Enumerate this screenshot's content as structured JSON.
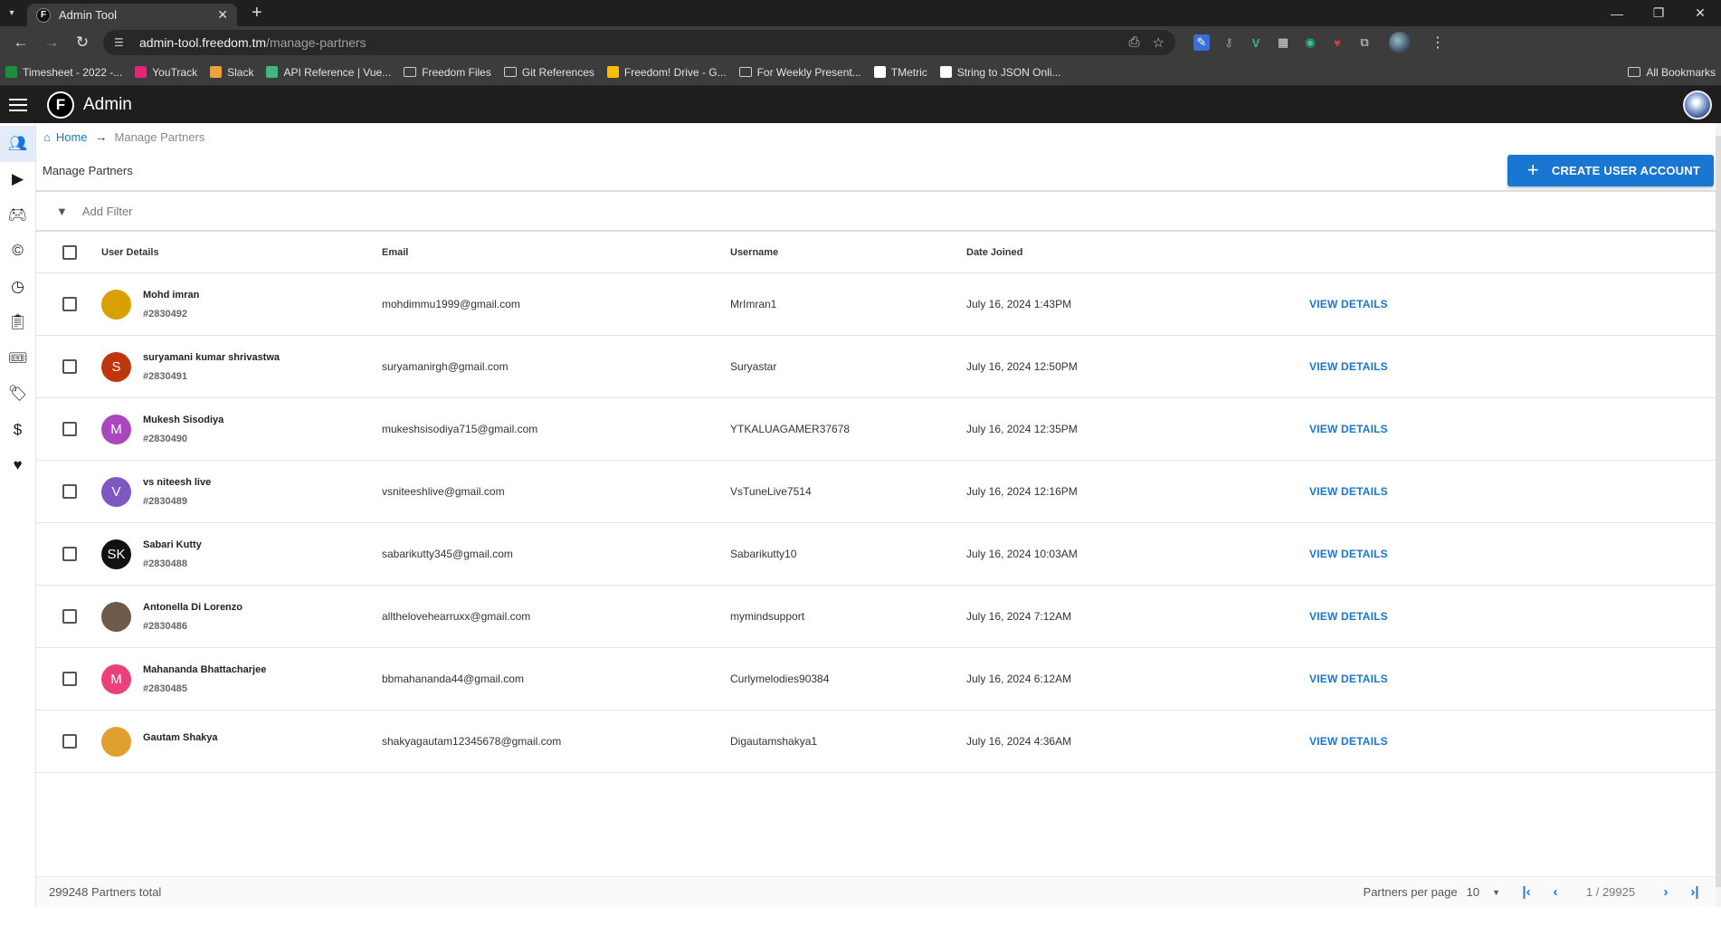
{
  "browser": {
    "tab_title": "Admin Tool",
    "url_host": "admin-tool.freedom.tm",
    "url_path": "/manage-partners",
    "bookmarks": [
      {
        "label": "Timesheet - 2022 -...",
        "icon": "sheets-icon",
        "color": "#1e8e3e"
      },
      {
        "label": "YouTrack",
        "icon": "youtrack-icon",
        "color": "#e6257a"
      },
      {
        "label": "Slack",
        "icon": "slack-icon",
        "color": "#e8a33d"
      },
      {
        "label": "API Reference | Vue...",
        "icon": "vue-icon",
        "color": "#41b883"
      },
      {
        "label": "Freedom Files",
        "icon": "folder-icon",
        "color": ""
      },
      {
        "label": "Git References",
        "icon": "folder-icon",
        "color": ""
      },
      {
        "label": "Freedom! Drive - G...",
        "icon": "drive-icon",
        "color": "#fbbc04"
      },
      {
        "label": "For Weekly Present...",
        "icon": "folder-icon",
        "color": ""
      },
      {
        "label": "TMetric",
        "icon": "tmetric-icon",
        "color": "#ffffff"
      },
      {
        "label": "String to JSON Onli...",
        "icon": "cb-icon",
        "color": "#ffffff"
      }
    ],
    "all_bookmarks": "All Bookmarks"
  },
  "app": {
    "title": "Admin",
    "logo_letter": "F"
  },
  "breadcrumb": {
    "home": "Home",
    "current": "Manage Partners"
  },
  "page": {
    "title": "Manage Partners",
    "create_button": "CREATE USER ACCOUNT",
    "filter_placeholder": "Add Filter"
  },
  "table": {
    "headers": {
      "user": "User Details",
      "email": "Email",
      "username": "Username",
      "date": "Date Joined"
    },
    "view_label": "VIEW DETAILS",
    "rows": [
      {
        "name": "Mohd imran",
        "id": "#2830492",
        "email": "mohdimmu1999@gmail.com",
        "username": "MrImran1",
        "date": "July 16, 2024 1:43PM",
        "avatar_letter": "",
        "avatar_color": "#d8a000"
      },
      {
        "name": "suryamani kumar shrivastwa",
        "id": "#2830491",
        "email": "suryamanirgh@gmail.com",
        "username": "Suryastar",
        "date": "July 16, 2024 12:50PM",
        "avatar_letter": "S",
        "avatar_color": "#bf360c"
      },
      {
        "name": "Mukesh Sisodiya",
        "id": "#2830490",
        "email": "mukeshsisodiya715@gmail.com",
        "username": "YTKALUAGAMER37678",
        "date": "July 16, 2024 12:35PM",
        "avatar_letter": "M",
        "avatar_color": "#ab47bc"
      },
      {
        "name": "vs niteesh live",
        "id": "#2830489",
        "email": "vsniteeshlive@gmail.com",
        "username": "VsTuneLive7514",
        "date": "July 16, 2024 12:16PM",
        "avatar_letter": "V",
        "avatar_color": "#7e57c2"
      },
      {
        "name": "Sabari Kutty",
        "id": "#2830488",
        "email": "sabarikutty345@gmail.com",
        "username": "Sabarikutty10",
        "date": "July 16, 2024 10:03AM",
        "avatar_letter": "SK",
        "avatar_color": "#111111"
      },
      {
        "name": "Antonella Di Lorenzo",
        "id": "#2830486",
        "email": "allthelovehearruxx@gmail.com",
        "username": "mymindsupport",
        "date": "July 16, 2024 7:12AM",
        "avatar_letter": "",
        "avatar_color": "#6d5a4a"
      },
      {
        "name": "Mahananda Bhattacharjee",
        "id": "#2830485",
        "email": "bbmahananda44@gmail.com",
        "username": "Curlymelodies90384",
        "date": "July 16, 2024 6:12AM",
        "avatar_letter": "M",
        "avatar_color": "#ec407a"
      },
      {
        "name": "Gautam Shakya",
        "id": "",
        "email": "shakyagautam12345678@gmail.com",
        "username": "Digautamshakya1",
        "date": "July 16, 2024 4:36AM",
        "avatar_letter": "",
        "avatar_color": "#e0a030"
      }
    ]
  },
  "footer": {
    "total": "299248 Partners total",
    "per_page_label": "Partners per page",
    "per_page_value": "10",
    "page_info": "1 / 29925"
  },
  "sidebar_icons": [
    "users-icon",
    "video-icon",
    "gamepad-icon",
    "copyright-icon",
    "clock-icon",
    "clipboard-icon",
    "ticket-icon",
    "tag-icon",
    "dollar-icon",
    "heart-icon"
  ]
}
